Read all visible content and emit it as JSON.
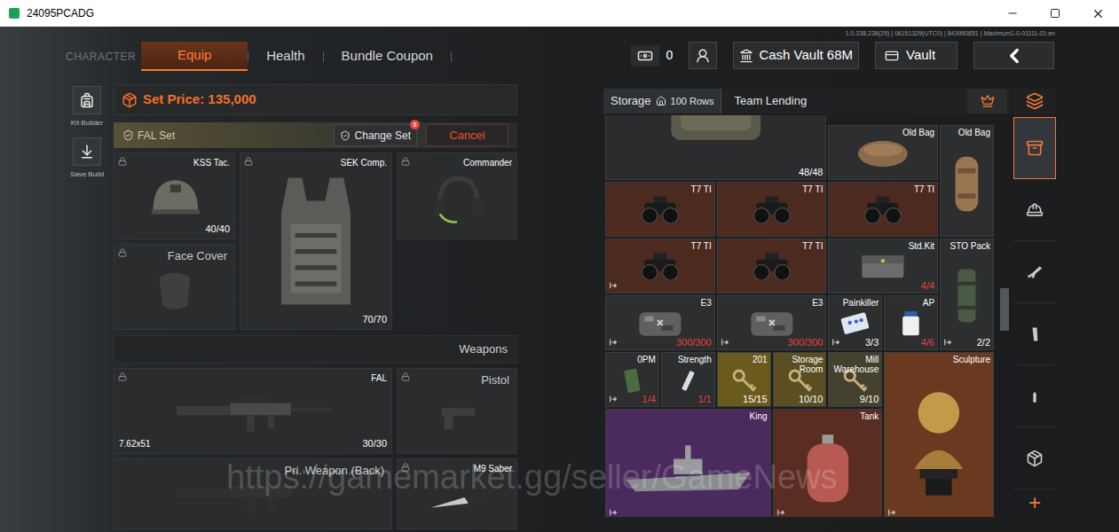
{
  "window": {
    "title": "24095PCADG"
  },
  "version": "1.0.238.238(25) | 06151329(UTC0) | 843950851 | Maximum1-0-01111-01:en",
  "nav": {
    "section": "CHARACTER",
    "tabs": [
      {
        "label": "Equip",
        "selected": true
      },
      {
        "label": "Health",
        "selected": false
      },
      {
        "label": "Bundle Coupon",
        "selected": false
      }
    ]
  },
  "header": {
    "cash": "0",
    "cash_vault": "Cash Vault 68M",
    "vault": "Vault"
  },
  "tools": [
    {
      "label": "Kit Builder"
    },
    {
      "label": "Save Build"
    }
  ],
  "equip": {
    "set_price": "Set Price: 135,000",
    "set_name": "FAL Set",
    "change_set": "Change Set",
    "change_set_badge": "8",
    "cancel": "Cancel",
    "gear": [
      {
        "label": "KSS Tac.",
        "durability": "40/40",
        "kind": "helmet",
        "filled": true,
        "locked": true
      },
      {
        "label": "SEK Comp.",
        "durability": "70/70",
        "kind": "vest",
        "filled": true,
        "locked": true
      },
      {
        "label": "Commander",
        "kind": "headset",
        "filled": true,
        "locked": true
      },
      {
        "label": "Face Cover",
        "kind": "face",
        "filled": false,
        "locked": true
      }
    ],
    "weapons_header": "Weapons",
    "weapons": [
      {
        "label": "FAL",
        "caliber": "7.62x51",
        "ammo": "30/30",
        "kind": "rifle",
        "filled": true,
        "locked": true
      },
      {
        "label": "Pistol",
        "kind": "pistol",
        "filled": false,
        "locked": true
      },
      {
        "label": "Pri. Weapon (Back)",
        "kind": "rifle",
        "filled": false,
        "locked": false
      },
      {
        "label": "M9 Saber",
        "kind": "knife",
        "filled": true,
        "locked": true
      }
    ]
  },
  "storage": {
    "tabs": [
      {
        "label": "Storage",
        "rows": "100 Rows",
        "selected": true
      },
      {
        "label": "Team Lending",
        "selected": false
      }
    ],
    "scroll": {
      "position": 0.43
    },
    "items": [
      {
        "kind": "vest",
        "count": "48/48",
        "countColor": "#ffffff",
        "color": "#2a2c2e",
        "marked": false
      },
      {
        "name": "Old Bag",
        "kind": "bag",
        "color": "#2c2e30",
        "marked": false
      },
      {
        "name": "Old Bag",
        "kind": "bag-tall",
        "color": "#2c2e30",
        "marked": false
      },
      {
        "name": "T7 TI",
        "kind": "nvg",
        "color": "#4d2a20",
        "marked": false
      },
      {
        "name": "T7 TI",
        "kind": "nvg",
        "color": "#4d2a20",
        "marked": false
      },
      {
        "name": "T7 TI",
        "kind": "nvg",
        "color": "#4d2a20",
        "marked": false
      },
      {
        "name": "T7 TI",
        "kind": "nvg",
        "color": "#4d2a20",
        "marked": true
      },
      {
        "name": "T7 TI",
        "kind": "nvg",
        "color": "#4d2a20",
        "marked": false
      },
      {
        "name": "Std.Kit",
        "kind": "kit",
        "count": "4/4",
        "countColor": "#e0453a",
        "color": "#2c2e30",
        "marked": false
      },
      {
        "name": "STO Pack",
        "kind": "pack",
        "count": "2/2",
        "countColor": "#ffffff",
        "color": "#2c2e30",
        "marked": true
      },
      {
        "name": "E3",
        "kind": "case",
        "count": "300/300",
        "countColor": "#e0453a",
        "color": "#2c2e30",
        "marked": true
      },
      {
        "name": "E3",
        "kind": "case",
        "count": "300/300",
        "countColor": "#e0453a",
        "color": "#2c2e30",
        "marked": true
      },
      {
        "name": "Painkiller",
        "kind": "pills",
        "count": "3/3",
        "countColor": "#ffffff",
        "color": "#2c2e30",
        "marked": true
      },
      {
        "name": "AP",
        "kind": "bottle",
        "count": "4/6",
        "countColor": "#e0453a",
        "color": "#2c2e30",
        "marked": false
      },
      {
        "name": "0PM",
        "kind": "food",
        "count": "1/4",
        "countColor": "#e0453a",
        "color": "#2c2e30",
        "marked": true
      },
      {
        "name": "Strength",
        "kind": "syringe",
        "count": "1/1",
        "countColor": "#e0453a",
        "color": "#2c2e30",
        "marked": false
      },
      {
        "name": "201",
        "kind": "key",
        "count": "15/15",
        "countColor": "#ffffff",
        "color": "#6b5a1e",
        "marked": false
      },
      {
        "name": "Storage Room",
        "kind": "key",
        "count": "10/10",
        "countColor": "#ffffff",
        "color": "#5a4e22",
        "marked": false
      },
      {
        "name": "Mill Warehouse",
        "kind": "key",
        "count": "9/10",
        "countColor": "#ffffff",
        "color": "#45412f",
        "marked": false
      },
      {
        "name": "Sculpture",
        "kind": "bust",
        "color": "#6a3a20",
        "marked": true
      },
      {
        "name": "King",
        "kind": "ship",
        "color": "#4b2a5e",
        "marked": true
      },
      {
        "name": "Tank",
        "kind": "tank",
        "color": "#5a2d22",
        "marked": true
      }
    ]
  },
  "categories": [
    {
      "selected": true
    },
    {
      "selected": false
    },
    {
      "selected": false
    },
    {
      "selected": false
    },
    {
      "selected": false
    },
    {
      "selected": false
    }
  ],
  "add": "+",
  "watermark": "https://gamemarket.gg/seller/GameNews"
}
